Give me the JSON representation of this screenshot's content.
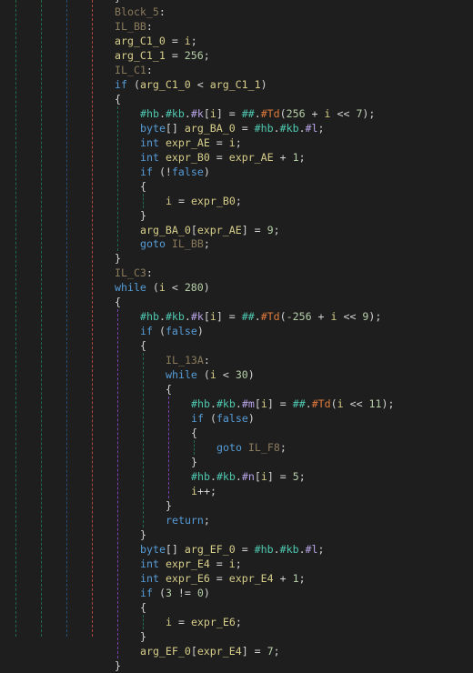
{
  "editor": {
    "theme": {
      "background": "#1e1e1e",
      "label_color": "#8a7a5c",
      "keyword_color": "#569cd6",
      "variable_color": "#d7ce8a",
      "number_color": "#b5cea8",
      "punctuation_color": "#d4d4d4",
      "field_color": "#4ec9b0",
      "member_color": "#b8a4e8",
      "method_color": "#e07a3a"
    },
    "guide_colors": [
      "#1f6b4a",
      "#1f6b4a",
      "#264f78",
      "#b0473f"
    ],
    "lines": [
      {
        "indent": 0,
        "tokens": [
          [
            "punc",
            "}"
          ]
        ]
      },
      {
        "indent": 0,
        "tokens": [
          [
            "label",
            "Block_5"
          ],
          [
            "punc",
            ":"
          ]
        ]
      },
      {
        "indent": 0,
        "tokens": [
          [
            "label",
            "IL_BB"
          ],
          [
            "punc",
            ":"
          ]
        ]
      },
      {
        "indent": 0,
        "tokens": [
          [
            "var",
            "arg_C1_0"
          ],
          [
            "punc",
            " = "
          ],
          [
            "var",
            "i"
          ],
          [
            "punc",
            ";"
          ]
        ]
      },
      {
        "indent": 0,
        "tokens": [
          [
            "var",
            "arg_C1_1"
          ],
          [
            "punc",
            " = "
          ],
          [
            "num",
            "256"
          ],
          [
            "punc",
            ";"
          ]
        ]
      },
      {
        "indent": 0,
        "tokens": [
          [
            "label",
            "IL_C1"
          ],
          [
            "punc",
            ":"
          ]
        ]
      },
      {
        "indent": 0,
        "tokens": [
          [
            "kw",
            "if"
          ],
          [
            "punc",
            " ("
          ],
          [
            "var",
            "arg_C1_0"
          ],
          [
            "punc",
            " < "
          ],
          [
            "var",
            "arg_C1_1"
          ],
          [
            "punc",
            ")"
          ]
        ]
      },
      {
        "indent": 0,
        "tokens": [
          [
            "punc",
            "{"
          ]
        ]
      },
      {
        "indent": 1,
        "tokens": [
          [
            "field",
            "#hb"
          ],
          [
            "punc",
            "."
          ],
          [
            "field",
            "#kb"
          ],
          [
            "punc",
            "."
          ],
          [
            "member",
            "#k"
          ],
          [
            "punc",
            "["
          ],
          [
            "var",
            "i"
          ],
          [
            "punc",
            "] = "
          ],
          [
            "field",
            "##"
          ],
          [
            "punc",
            "."
          ],
          [
            "method",
            "#Td"
          ],
          [
            "punc",
            "("
          ],
          [
            "num",
            "256"
          ],
          [
            "punc",
            " + "
          ],
          [
            "var",
            "i"
          ],
          [
            "punc",
            " << "
          ],
          [
            "num",
            "7"
          ],
          [
            "punc",
            ");"
          ]
        ]
      },
      {
        "indent": 1,
        "tokens": [
          [
            "kw",
            "byte"
          ],
          [
            "punc",
            "[] "
          ],
          [
            "var",
            "arg_BA_0"
          ],
          [
            "punc",
            " = "
          ],
          [
            "field",
            "#hb"
          ],
          [
            "punc",
            "."
          ],
          [
            "field",
            "#kb"
          ],
          [
            "punc",
            "."
          ],
          [
            "member",
            "#l"
          ],
          [
            "punc",
            ";"
          ]
        ]
      },
      {
        "indent": 1,
        "tokens": [
          [
            "kw",
            "int"
          ],
          [
            "punc",
            " "
          ],
          [
            "var",
            "expr_AE"
          ],
          [
            "punc",
            " = "
          ],
          [
            "var",
            "i"
          ],
          [
            "punc",
            ";"
          ]
        ]
      },
      {
        "indent": 1,
        "tokens": [
          [
            "kw",
            "int"
          ],
          [
            "punc",
            " "
          ],
          [
            "var",
            "expr_B0"
          ],
          [
            "punc",
            " = "
          ],
          [
            "var",
            "expr_AE"
          ],
          [
            "punc",
            " + "
          ],
          [
            "num",
            "1"
          ],
          [
            "punc",
            ";"
          ]
        ]
      },
      {
        "indent": 1,
        "tokens": [
          [
            "kw",
            "if"
          ],
          [
            "punc",
            " (!"
          ],
          [
            "kw",
            "false"
          ],
          [
            "punc",
            ")"
          ]
        ]
      },
      {
        "indent": 1,
        "tokens": [
          [
            "punc",
            "{"
          ]
        ]
      },
      {
        "indent": 2,
        "tokens": [
          [
            "var",
            "i"
          ],
          [
            "punc",
            " = "
          ],
          [
            "var",
            "expr_B0"
          ],
          [
            "punc",
            ";"
          ]
        ]
      },
      {
        "indent": 1,
        "tokens": [
          [
            "punc",
            "}"
          ]
        ]
      },
      {
        "indent": 1,
        "tokens": [
          [
            "var",
            "arg_BA_0"
          ],
          [
            "punc",
            "["
          ],
          [
            "var",
            "expr_AE"
          ],
          [
            "punc",
            "] = "
          ],
          [
            "num",
            "9"
          ],
          [
            "punc",
            ";"
          ]
        ]
      },
      {
        "indent": 1,
        "tokens": [
          [
            "kw",
            "goto"
          ],
          [
            "punc",
            " "
          ],
          [
            "label",
            "IL_BB"
          ],
          [
            "punc",
            ";"
          ]
        ]
      },
      {
        "indent": 0,
        "tokens": [
          [
            "punc",
            "}"
          ]
        ]
      },
      {
        "indent": 0,
        "tokens": [
          [
            "label",
            "IL_C3"
          ],
          [
            "punc",
            ":"
          ]
        ]
      },
      {
        "indent": 0,
        "tokens": [
          [
            "kw",
            "while"
          ],
          [
            "punc",
            " ("
          ],
          [
            "var",
            "i"
          ],
          [
            "punc",
            " < "
          ],
          [
            "num",
            "280"
          ],
          [
            "punc",
            ")"
          ]
        ]
      },
      {
        "indent": 0,
        "tokens": [
          [
            "punc",
            "{"
          ]
        ]
      },
      {
        "indent": 1,
        "tokens": [
          [
            "field",
            "#hb"
          ],
          [
            "punc",
            "."
          ],
          [
            "field",
            "#kb"
          ],
          [
            "punc",
            "."
          ],
          [
            "member",
            "#k"
          ],
          [
            "punc",
            "["
          ],
          [
            "var",
            "i"
          ],
          [
            "punc",
            "] = "
          ],
          [
            "field",
            "##"
          ],
          [
            "punc",
            "."
          ],
          [
            "method",
            "#Td"
          ],
          [
            "punc",
            "("
          ],
          [
            "num",
            "-256"
          ],
          [
            "punc",
            " + "
          ],
          [
            "var",
            "i"
          ],
          [
            "punc",
            " << "
          ],
          [
            "num",
            "9"
          ],
          [
            "punc",
            ");"
          ]
        ]
      },
      {
        "indent": 1,
        "tokens": [
          [
            "kw",
            "if"
          ],
          [
            "punc",
            " ("
          ],
          [
            "kw",
            "false"
          ],
          [
            "punc",
            ")"
          ]
        ]
      },
      {
        "indent": 1,
        "tokens": [
          [
            "punc",
            "{"
          ]
        ]
      },
      {
        "indent": 2,
        "tokens": [
          [
            "label",
            "IL_13A"
          ],
          [
            "punc",
            ":"
          ]
        ]
      },
      {
        "indent": 2,
        "tokens": [
          [
            "kw",
            "while"
          ],
          [
            "punc",
            " ("
          ],
          [
            "var",
            "i"
          ],
          [
            "punc",
            " < "
          ],
          [
            "num",
            "30"
          ],
          [
            "punc",
            ")"
          ]
        ]
      },
      {
        "indent": 2,
        "tokens": [
          [
            "punc",
            "{"
          ]
        ]
      },
      {
        "indent": 3,
        "tokens": [
          [
            "field",
            "#hb"
          ],
          [
            "punc",
            "."
          ],
          [
            "field",
            "#kb"
          ],
          [
            "punc",
            "."
          ],
          [
            "member",
            "#m"
          ],
          [
            "punc",
            "["
          ],
          [
            "var",
            "i"
          ],
          [
            "punc",
            "] = "
          ],
          [
            "field",
            "##"
          ],
          [
            "punc",
            "."
          ],
          [
            "method",
            "#Td"
          ],
          [
            "punc",
            "("
          ],
          [
            "var",
            "i"
          ],
          [
            "punc",
            " << "
          ],
          [
            "num",
            "11"
          ],
          [
            "punc",
            ");"
          ]
        ]
      },
      {
        "indent": 3,
        "tokens": [
          [
            "kw",
            "if"
          ],
          [
            "punc",
            " ("
          ],
          [
            "kw",
            "false"
          ],
          [
            "punc",
            ")"
          ]
        ]
      },
      {
        "indent": 3,
        "tokens": [
          [
            "punc",
            "{"
          ]
        ]
      },
      {
        "indent": 4,
        "tokens": [
          [
            "kw",
            "goto"
          ],
          [
            "punc",
            " "
          ],
          [
            "label",
            "IL_F8"
          ],
          [
            "punc",
            ";"
          ]
        ]
      },
      {
        "indent": 3,
        "tokens": [
          [
            "punc",
            "}"
          ]
        ]
      },
      {
        "indent": 3,
        "tokens": [
          [
            "field",
            "#hb"
          ],
          [
            "punc",
            "."
          ],
          [
            "field",
            "#kb"
          ],
          [
            "punc",
            "."
          ],
          [
            "member",
            "#n"
          ],
          [
            "punc",
            "["
          ],
          [
            "var",
            "i"
          ],
          [
            "punc",
            "] = "
          ],
          [
            "num",
            "5"
          ],
          [
            "punc",
            ";"
          ]
        ]
      },
      {
        "indent": 3,
        "tokens": [
          [
            "var",
            "i"
          ],
          [
            "punc",
            "++;"
          ]
        ]
      },
      {
        "indent": 2,
        "tokens": [
          [
            "punc",
            "}"
          ]
        ]
      },
      {
        "indent": 2,
        "tokens": [
          [
            "kw",
            "return"
          ],
          [
            "punc",
            ";"
          ]
        ]
      },
      {
        "indent": 1,
        "tokens": [
          [
            "punc",
            "}"
          ]
        ]
      },
      {
        "indent": 1,
        "tokens": [
          [
            "kw",
            "byte"
          ],
          [
            "punc",
            "[] "
          ],
          [
            "var",
            "arg_EF_0"
          ],
          [
            "punc",
            " = "
          ],
          [
            "field",
            "#hb"
          ],
          [
            "punc",
            "."
          ],
          [
            "field",
            "#kb"
          ],
          [
            "punc",
            "."
          ],
          [
            "member",
            "#l"
          ],
          [
            "punc",
            ";"
          ]
        ]
      },
      {
        "indent": 1,
        "tokens": [
          [
            "kw",
            "int"
          ],
          [
            "punc",
            " "
          ],
          [
            "var",
            "expr_E4"
          ],
          [
            "punc",
            " = "
          ],
          [
            "var",
            "i"
          ],
          [
            "punc",
            ";"
          ]
        ]
      },
      {
        "indent": 1,
        "tokens": [
          [
            "kw",
            "int"
          ],
          [
            "punc",
            " "
          ],
          [
            "var",
            "expr_E6"
          ],
          [
            "punc",
            " = "
          ],
          [
            "var",
            "expr_E4"
          ],
          [
            "punc",
            " + "
          ],
          [
            "num",
            "1"
          ],
          [
            "punc",
            ";"
          ]
        ]
      },
      {
        "indent": 1,
        "tokens": [
          [
            "kw",
            "if"
          ],
          [
            "punc",
            " ("
          ],
          [
            "num",
            "3"
          ],
          [
            "punc",
            " != "
          ],
          [
            "num",
            "0"
          ],
          [
            "punc",
            ")"
          ]
        ]
      },
      {
        "indent": 1,
        "tokens": [
          [
            "punc",
            "{"
          ]
        ]
      },
      {
        "indent": 2,
        "tokens": [
          [
            "var",
            "i"
          ],
          [
            "punc",
            " = "
          ],
          [
            "var",
            "expr_E6"
          ],
          [
            "punc",
            ";"
          ]
        ]
      },
      {
        "indent": 1,
        "tokens": [
          [
            "punc",
            "}"
          ]
        ]
      },
      {
        "indent": 1,
        "tokens": [
          [
            "var",
            "arg_EF_0"
          ],
          [
            "punc",
            "["
          ],
          [
            "var",
            "expr_E4"
          ],
          [
            "punc",
            "] = "
          ],
          [
            "num",
            "7"
          ],
          [
            "punc",
            ";"
          ]
        ]
      },
      {
        "indent": 0,
        "tokens": [
          [
            "punc",
            "}"
          ]
        ]
      }
    ]
  }
}
